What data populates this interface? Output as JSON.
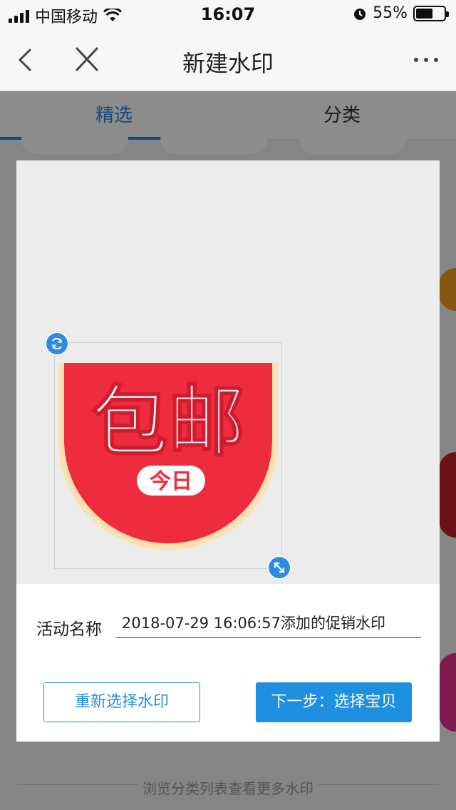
{
  "status_bar": {
    "carrier": "中国移动",
    "time": "16:07",
    "battery_text": "55%",
    "battery_level": 0.55
  },
  "nav": {
    "title": "新建水印",
    "icons": [
      "back-chevron-icon",
      "close-icon",
      "more-icon"
    ]
  },
  "tabs": [
    {
      "label": "精选",
      "active": true
    },
    {
      "label": "分类",
      "active": false
    }
  ],
  "footer_hint": "浏览分类列表查看更多水印",
  "modal": {
    "watermark": {
      "main_text": "包邮",
      "badge_text": "今日",
      "colors": {
        "fill": "#ef2b3e",
        "rim": "#fce1b0",
        "text": "#ffffff",
        "badge_text": "#ef2b3e"
      }
    },
    "name_label": "活动名称",
    "name_value": "2018-07-29 16:06:57添加的促销水印",
    "reselect_label": "重新选择水印",
    "next_label": "下一步：选择宝贝"
  },
  "colors": {
    "accent": "#1f8fe0",
    "handle": "#2f8be0"
  }
}
